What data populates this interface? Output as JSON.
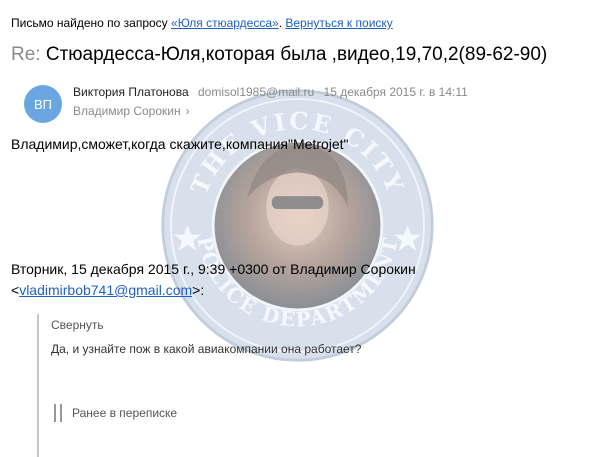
{
  "search_bar": {
    "prefix": "Письмо найдено по запросу ",
    "query_link": "«Юля стюардесса»",
    "separator": ". ",
    "back_link": "Вернуться к поиску"
  },
  "message": {
    "subject_prefix": "Re:",
    "subject": " Стюардесса-Юля,которая была ,видео,19,70,2(89-62-90)",
    "avatar_initials": "ВП",
    "avatar_color": "#6aa7e0",
    "sender_name": "Виктория Платонова",
    "sender_email": "domisol1985@mail.ru",
    "date": "15 декабря 2015 г. в 14:11",
    "recipient": "Владимир Сорокин",
    "body": "Владимир,сможет,когда скажите,компания\"Metrojet\"",
    "quote_header_before": "Вторник, 15 декабря 2015 г., 9:39 +0300 от Владимир Сорокин <",
    "quote_email": "vladimirbob741@gmail.com",
    "quote_header_after": ">:",
    "collapse_label": "Свернуть",
    "quoted_text": "Да, и узнайте пож в какой авиакомпании она работает?",
    "earlier_label": "Ранее в переписке"
  },
  "watermark": {
    "top_text": "THE VICE CITY",
    "bottom_text": "POLICE DEPARTMENT"
  },
  "colors": {
    "link": "#1f5fc6",
    "muted": "#8a8a8a"
  }
}
